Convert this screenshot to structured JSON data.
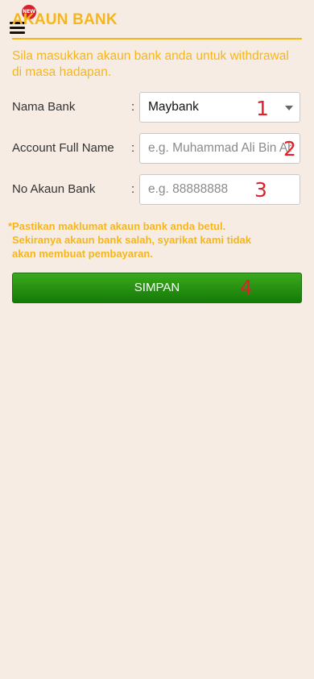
{
  "header": {
    "title": "AKAUN BANK",
    "new_badge": "NEW"
  },
  "intro_text": "Sila masukkan akaun bank anda untuk withdrawal di masa hadapan.",
  "form": {
    "bank_name": {
      "label": "Nama Bank",
      "colon": ":",
      "selected": "Maybank"
    },
    "full_name": {
      "label": "Account Full Name",
      "colon": ":",
      "placeholder": "e.g. Muhammad Ali Bin Abu"
    },
    "account_no": {
      "label": "No Akaun Bank",
      "colon": ":",
      "placeholder": "e.g. 88888888"
    }
  },
  "note": {
    "line1": "*Pastikan maklumat akaun bank anda betul.",
    "line2": "Sekiranya akaun bank salah, syarikat kami tidak",
    "line3": "akan membuat pembayaran."
  },
  "save_label": "SIMPAN",
  "annotations": [
    "1",
    "2",
    "3",
    "4"
  ],
  "colors": {
    "accent": "#f6b61b",
    "background": "#f6ece3",
    "button_green": "#1f8a0f",
    "annotation_red": "#e0202a",
    "badge_red": "#d8202a"
  },
  "icons": {
    "menu": "hamburger-menu-icon",
    "dropdown": "caret-down-icon"
  }
}
